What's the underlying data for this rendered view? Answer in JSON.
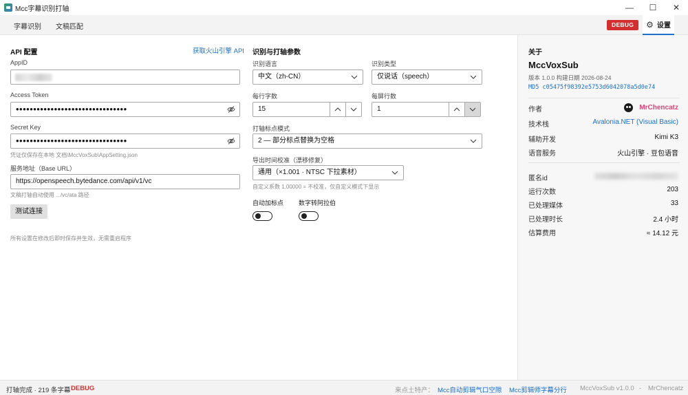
{
  "window": {
    "title": "Mcc字幕识别打轴",
    "min": "—",
    "max": "☐",
    "close": "✕"
  },
  "nav": {
    "tabs": [
      "字幕识别",
      "文稿匹配"
    ],
    "debug": "DEBUG",
    "settings": "设置"
  },
  "api": {
    "title": "API 配置",
    "link": "获取火山引擎 API",
    "appid_label": "AppID",
    "token_label": "Access Token",
    "token_value": "••••••••••••••••••••••••••••••••",
    "secret_label": "Secret Key",
    "secret_value": "••••••••••••••••••••••••••••••••",
    "secret_hint": "凭证仅保存在本地 文档\\MccVoxSub\\AppSetting.json",
    "url_label": "服务地址（Base URL）",
    "url_value": "https://openspeech.bytedance.com/api/v1/vc",
    "url_hint": "文稿打轴自动使用 .../vc/ata 路径",
    "test_button": "测试连接",
    "footer_hint": "所有设置在修改后即时保存并生效，无需重启程序"
  },
  "params": {
    "title": "识别与打轴参数",
    "lang_label": "识别语言",
    "lang_value": "中文（zh-CN）",
    "type_label": "识别类型",
    "type_value": "仅说话（speech）",
    "chars_label": "每行字数",
    "chars_value": "15",
    "lines_label": "每屏行数",
    "lines_value": "1",
    "punct_label": "打轴标点模式",
    "punct_value": "2 — 部分标点替换为空格",
    "time_label": "导出时间校准（漂移修复）",
    "time_value": "通用（×1.001 · NTSC 下拉素材）",
    "time_hint": "自定义系数 1.00000 = 不校准，仅自定义模式下显示",
    "auto_punct_label": "自动加标点",
    "num_label": "数字转阿拉伯"
  },
  "about": {
    "title": "关于",
    "app_name": "MccVoxSub",
    "version": "版本 1.0.0    构建日期 2026-08-24",
    "md5": "MD5 c05475f98392e5753d6042078a5d0e74",
    "author_k": "作者",
    "author_v": "MrChencatz",
    "stack_k": "技术栈",
    "stack_v": "Avalonia.NET (Visual Basic)",
    "assist_k": "辅助开发",
    "assist_v": "Kimi K3",
    "speech_k": "语音服务",
    "speech_v": "火山引擎 · 豆包语音",
    "anon_k": "匿名id",
    "runs_k": "运行次数",
    "runs_v": "203",
    "media_k": "已处理媒体",
    "media_v": "33",
    "dur_k": "已处理时长",
    "dur_v": "2.4 小时",
    "cost_k": "估算费用",
    "cost_v": "≈ 14.12 元"
  },
  "status": {
    "left": "打轴完成 · 219 条字幕",
    "debug": "DEBUG",
    "promo": "来点土特产：",
    "link1": "Mcc自动剪辑气口空隙",
    "link2": "Mcc剪辑师字幕分行",
    "version": "MccVoxSub v1.0.0",
    "sep": "-",
    "author": "MrChencatz"
  }
}
